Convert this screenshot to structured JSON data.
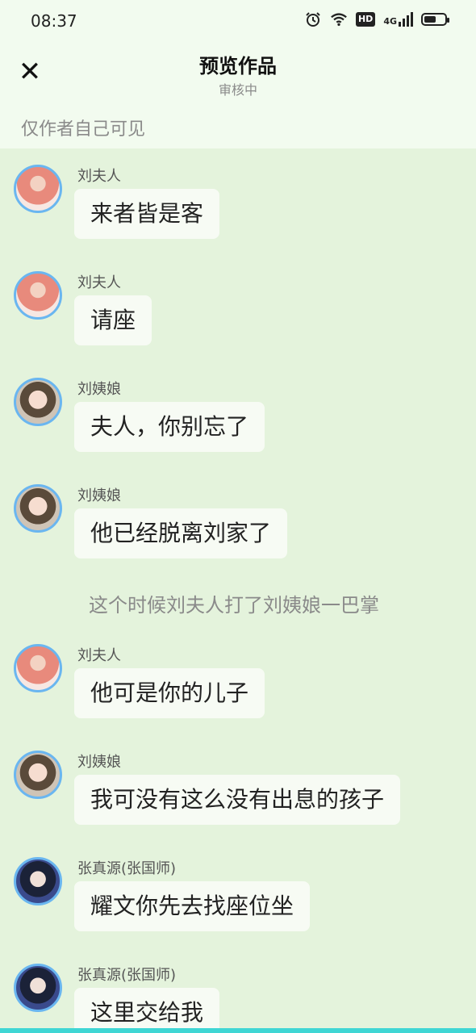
{
  "status_bar": {
    "time": "08:37",
    "icons": [
      "alarm-icon",
      "wifi-icon",
      "hd-icon",
      "4g-signal-icon",
      "battery-icon"
    ],
    "network": "4G",
    "hd": "HD"
  },
  "header": {
    "close_icon": "✕",
    "title": "预览作品",
    "subtitle": "审核中",
    "visibility_note": "仅作者自己可见"
  },
  "messages": [
    {
      "name": "刘夫人",
      "text": "来者皆是客"
    },
    {
      "name": "刘夫人",
      "text": "请座"
    },
    {
      "name": "刘姨娘",
      "text": "夫人，你别忘了"
    },
    {
      "name": "刘姨娘",
      "text": "他已经脱离刘家了"
    },
    {
      "name": "刘夫人",
      "text": "他可是你的儿子"
    },
    {
      "name": "刘姨娘",
      "text": "我可没有这么没有出息的孩子"
    },
    {
      "name": "张真源(张国师)",
      "text": "耀文你先去找座位坐"
    },
    {
      "name": "张真源(张国师)",
      "text": "这里交给我"
    }
  ],
  "narration": "这个时候刘夫人打了刘姨娘一巴掌",
  "colors": {
    "header_bg": "#f2fbef",
    "chat_bg": "#e4f3dc",
    "bubble_bg": "#f7fbf4",
    "avatar_border": "#6ab6f0",
    "bottom_accent": "#3fd6d4"
  }
}
